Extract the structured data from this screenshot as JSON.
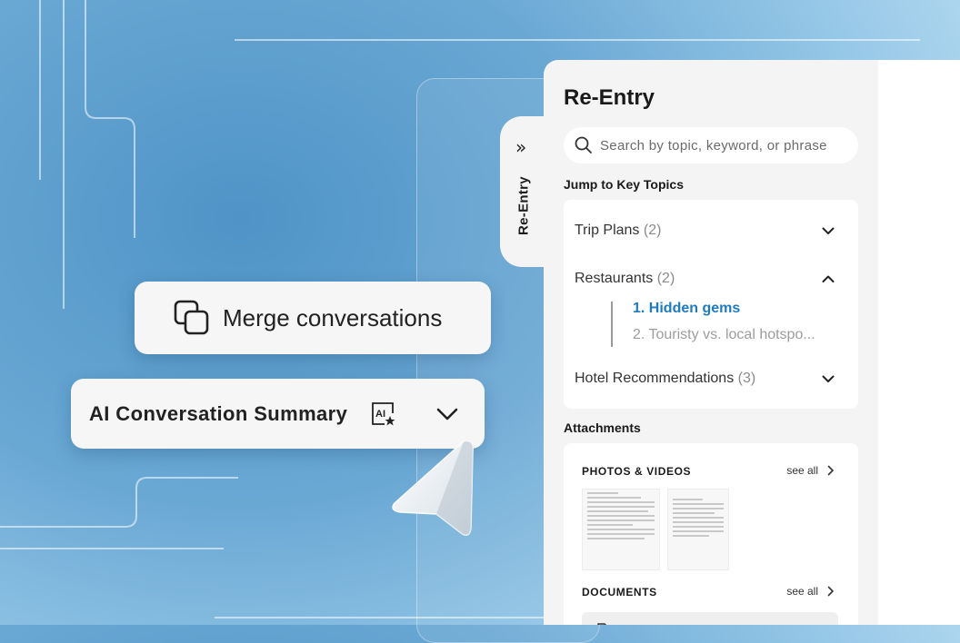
{
  "panel": {
    "tab_label": "Re-Entry",
    "title": "Re-Entry",
    "search_placeholder": "Search by topic, keyword, or phrase",
    "jump_label": "Jump to Key Topics",
    "topics": [
      {
        "name": "Trip Plans",
        "count": "(2)",
        "expanded": false
      },
      {
        "name": "Restaurants",
        "count": "(2)",
        "expanded": true
      },
      {
        "name": "Hotel Recommendations",
        "count": "(3)",
        "expanded": false
      }
    ],
    "subtopics": [
      {
        "label": "1. Hidden gems",
        "active": true
      },
      {
        "label": "2. Touristy vs. local hotspo...",
        "active": false
      }
    ],
    "attachments_label": "Attachments",
    "photos_label": "PHOTOS & VIDEOS",
    "documents_label": "DOCUMENTS",
    "see_all": "see all"
  },
  "floating": {
    "merge_label": "Merge conversations",
    "summary_label": "AI Conversation Summary",
    "ai_badge": "AI"
  },
  "colors": {
    "accent": "#1e7bbf",
    "panel_bg": "#f4f4f4",
    "background": "#6aa8d4"
  },
  "icons": [
    "chevrons-right-icon",
    "search-icon",
    "chevron-down-icon",
    "chevron-up-icon",
    "chevron-right-icon",
    "merge-icon",
    "ai-sparkle-icon",
    "cursor-arrow-icon"
  ]
}
